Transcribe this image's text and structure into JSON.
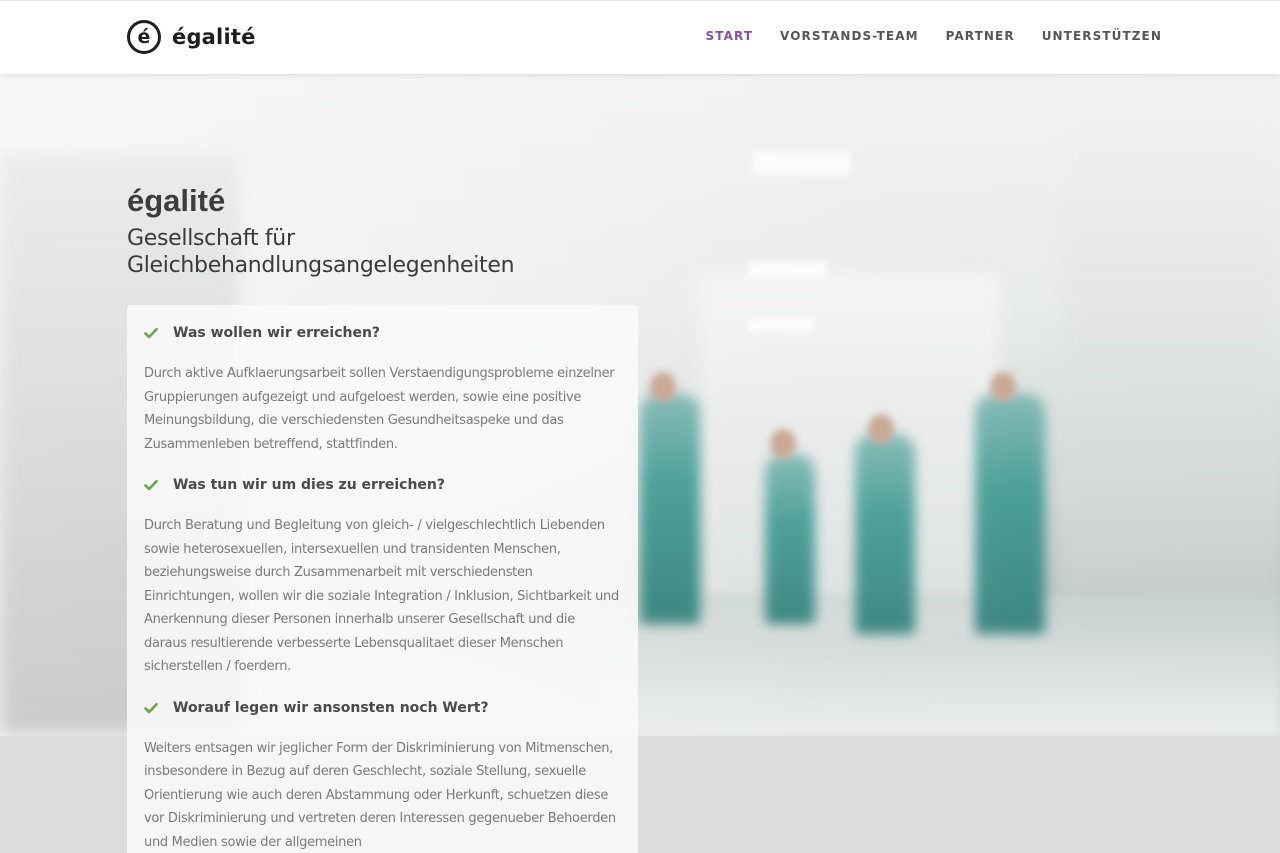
{
  "brand": {
    "logo_glyph": "é",
    "name": "égalité"
  },
  "nav": {
    "items": [
      {
        "label": "START",
        "active": true
      },
      {
        "label": "VORSTANDS-TEAM",
        "active": false
      },
      {
        "label": "PARTNER",
        "active": false
      },
      {
        "label": "UNTERSTÜTZEN",
        "active": false
      }
    ]
  },
  "hero": {
    "title": "égalité",
    "subtitle": "Gesellschaft für Gleichbehandlungsangelegenheiten"
  },
  "sections": [
    {
      "heading": "Was wollen wir erreichen?",
      "text": "Durch aktive Aufklaerungsarbeit sollen Verstaendigungsprobleme einzelner Gruppierungen aufgezeigt und aufgeloest werden, sowie eine positive Meinungsbildung, die verschiedensten Gesundheitsaspeke und das Zusammenleben betreffend, stattfinden."
    },
    {
      "heading": "Was tun wir um dies zu erreichen?",
      "text": "Durch Beratung und Begleitung von gleich- / vielgeschlechtlich Liebenden sowie heterosexuellen, intersexuellen und transidenten Menschen, beziehungsweise durch Zusammenarbeit mit verschiedensten Einrichtungen, wollen wir die soziale Integration / Inklusion, Sichtbarkeit und Anerkennung dieser Personen innerhalb unserer Gesellschaft und die daraus resultierende verbesserte Lebensqualitaet dieser Menschen sicherstellen / foerdern."
    },
    {
      "heading": "Worauf legen wir ansonsten noch Wert?",
      "text": "Weiters entsagen wir jeglicher Form der Diskriminierung von Mitmenschen, insbesondere in Bezug auf deren Geschlecht, soziale Stellung, sexuelle Orientierung wie auch deren Abstammung oder Herkunft, schuetzen diese vor Diskriminierung und vertreten deren Interessen gegenueber Behoerden und Medien sowie der allgemeinen"
    }
  ],
  "colors": {
    "accent": "#8a4fa3",
    "check": "#6aa84f"
  },
  "icons": {
    "check": "check-icon"
  }
}
